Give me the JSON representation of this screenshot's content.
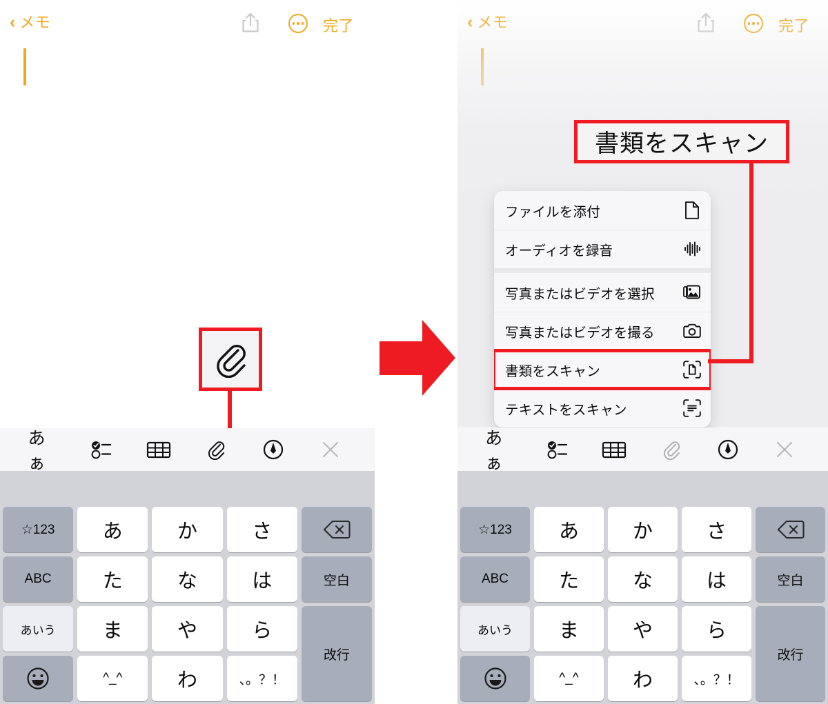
{
  "nav": {
    "back_chevron": "‹",
    "back_label": "メモ",
    "share_icon": "share-icon",
    "more_icon": "ellipsis-circle-icon",
    "done_label": "完了"
  },
  "callout": {
    "text": "書類をスキャン",
    "accent_color": "#ee1c22"
  },
  "attachment_menu": {
    "items": [
      {
        "label": "ファイルを添付",
        "icon": "document-icon",
        "group": 0,
        "highlighted": false
      },
      {
        "label": "オーディオを録音",
        "icon": "waveform-icon",
        "group": 0,
        "highlighted": false
      },
      {
        "label": "写真またはビデオを選択",
        "icon": "photo-library-icon",
        "group": 1,
        "highlighted": false
      },
      {
        "label": "写真またはビデオを撮る",
        "icon": "camera-icon",
        "group": 1,
        "highlighted": false
      },
      {
        "label": "書類をスキャン",
        "icon": "scan-document-icon",
        "group": 1,
        "highlighted": true
      },
      {
        "label": "テキストをスキャン",
        "icon": "scan-text-icon",
        "group": 1,
        "highlighted": false
      }
    ]
  },
  "toolbar": {
    "items": [
      {
        "name": "format-text-button",
        "icon": "aa-icon",
        "label": "あぁ",
        "dimmed_right": false
      },
      {
        "name": "checklist-button",
        "icon": "checklist-icon",
        "label": "",
        "dimmed_right": false
      },
      {
        "name": "table-button",
        "icon": "table-icon",
        "label": "",
        "dimmed_right": false
      },
      {
        "name": "attach-button",
        "icon": "paperclip-icon",
        "label": "",
        "dimmed_right": true
      },
      {
        "name": "markup-button",
        "icon": "markup-pen-icon",
        "label": "",
        "dimmed_right": false
      },
      {
        "name": "close-keyboard-button",
        "icon": "close-x-icon",
        "label": "",
        "dimmed_right": false
      }
    ]
  },
  "keyboard": {
    "keys": [
      {
        "label": "☆123",
        "style": "gray small",
        "name": "key-symbols"
      },
      {
        "label": "あ",
        "style": "white",
        "name": "key-a"
      },
      {
        "label": "か",
        "style": "white",
        "name": "key-ka"
      },
      {
        "label": "さ",
        "style": "white",
        "name": "key-sa"
      },
      {
        "label": "",
        "style": "gray",
        "name": "key-backspace",
        "icon": "backspace-icon"
      },
      {
        "label": "ABC",
        "style": "gray small",
        "name": "key-abc"
      },
      {
        "label": "た",
        "style": "white",
        "name": "key-ta"
      },
      {
        "label": "な",
        "style": "white",
        "name": "key-na"
      },
      {
        "label": "は",
        "style": "white",
        "name": "key-ha"
      },
      {
        "label": "空白",
        "style": "gray small",
        "name": "key-space"
      },
      {
        "label": "あいう",
        "style": "light tiny",
        "name": "key-kana"
      },
      {
        "label": "ま",
        "style": "white",
        "name": "key-ma"
      },
      {
        "label": "や",
        "style": "white",
        "name": "key-ya"
      },
      {
        "label": "ら",
        "style": "white",
        "name": "key-ra"
      },
      {
        "label": "改行",
        "style": "gray small span2",
        "name": "key-return"
      },
      {
        "label": "",
        "style": "gray",
        "name": "key-emoji",
        "icon": "emoji-icon"
      },
      {
        "label": "^_^",
        "style": "white small",
        "name": "key-kaomoji"
      },
      {
        "label": "わ",
        "style": "white",
        "name": "key-wa"
      },
      {
        "label": "、。？！",
        "style": "white small",
        "name": "key-punctuation"
      }
    ]
  }
}
